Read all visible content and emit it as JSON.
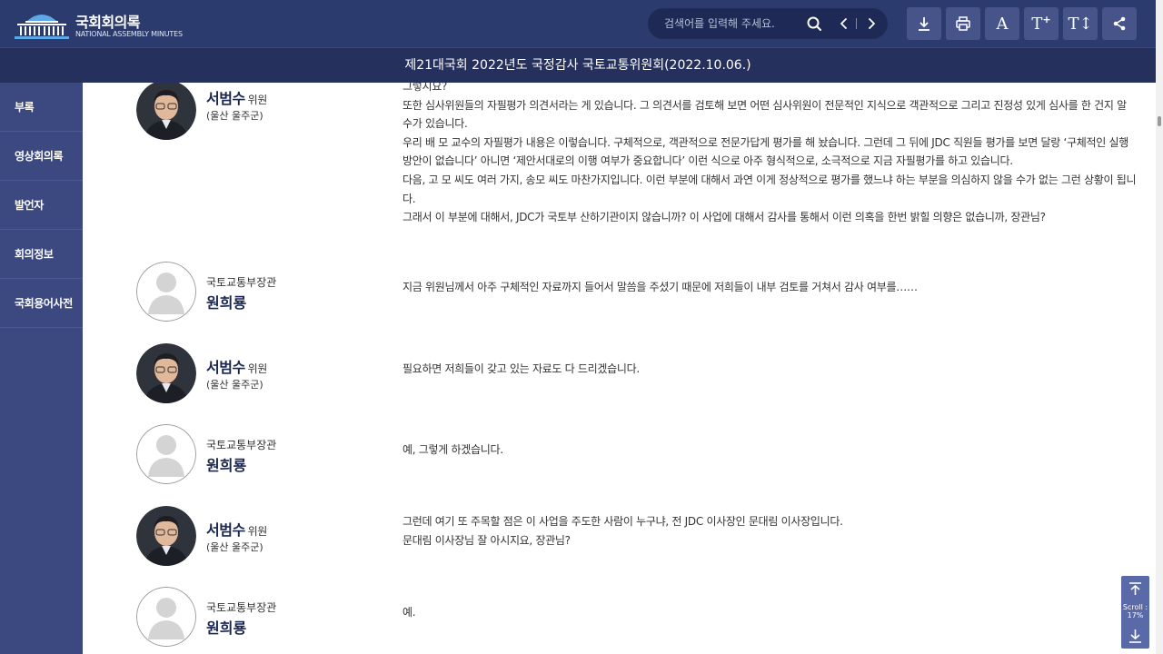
{
  "header": {
    "logo_title": "국회회의록",
    "logo_subtitle": "NATIONAL ASSEMBLY MINUTES",
    "search_placeholder": "검색어를 입력해 주세요.",
    "tools": [
      "download-icon",
      "print-icon",
      "font-style-icon",
      "font-size-increase-icon",
      "font-size-adjust-icon",
      "share-icon"
    ],
    "colors": {
      "header_bg": "#2c3b6e",
      "title_bg": "#26305c",
      "sidebar_bg": "#3c4880",
      "tool_bg": "#46548a"
    }
  },
  "meeting_title": "제21대국회 2022년도 국정감사 국토교통위원회(2022.10.06.)",
  "sidebar": {
    "items": [
      {
        "label": "부록"
      },
      {
        "label": "영상회의록"
      },
      {
        "label": "발언자"
      },
      {
        "label": "회의정보"
      },
      {
        "label": "국회용어사전"
      }
    ]
  },
  "entries": [
    {
      "speaker": "서범수",
      "role": "위원",
      "district": "(울산 울주군)",
      "lines": [
        "그렇지요?",
        " 또한 심사위원들의 자필평가 의견서라는 게 있습니다. 그 의견서를 검토해 보면 어떤 심사위원이 전문적인 지식으로 객관적으로 그리고 진정성 있게 심사를 한 건지 알 수가 있습니다.",
        " 우리 배 모 교수의 자필평가 내용은 이렇습니다. 구체적으로, 객관적으로 전문가답게 평가를 해 놨습니다. 그런데 그 뒤에 JDC 직원들 평가를 보면 달랑 ‘구체적인 실행 방안이 없습니다’ 아니면 ‘제안서대로의 이행 여부가 중요합니다’ 이런 식으로 아주 형식적으로, 소극적으로 지금 자필평가를 하고 있습니다.",
        " 다음, 고 모 씨도 여러 가지, 송모 씨도 마찬가지입니다. 이런 부분에 대해서 과연 이게 정상적으로 평가를 했느냐 하는 부분을 의심하지 않을 수가 없는 그런 상황이 됩니다.",
        " 그래서 이 부분에 대해서, JDC가 국토부 산하기관이지 않습니까? 이 사업에 대해서 감사를 통해서 이런 의혹을 한번 밝힐 의향은 없습니까, 장관님?"
      ]
    },
    {
      "speaker_title": "국토교통부장관",
      "speaker": "원희룡",
      "lines": [
        "지금 위원님께서 아주 구체적인 자료까지 들어서 말씀을 주셨기 때문에 저희들이 내부 검토를 거쳐서 감사 여부를……"
      ]
    },
    {
      "speaker": "서범수",
      "role": "위원",
      "district": "(울산 울주군)",
      "lines": [
        "필요하면 저희들이 갖고 있는 자료도 다 드리겠습니다."
      ]
    },
    {
      "speaker_title": "국토교통부장관",
      "speaker": "원희룡",
      "lines": [
        "예, 그렇게 하겠습니다."
      ]
    },
    {
      "speaker": "서범수",
      "role": "위원",
      "district": "(울산 울주군)",
      "lines": [
        "그런데 여기 또 주목할 점은 이 사업을 주도한 사람이 누구냐, 전 JDC 이사장인 문대림 이사장입니다.",
        "문대림 이사장님 잘 아시지요, 장관님?"
      ]
    },
    {
      "speaker_title": "국토교통부장관",
      "speaker": "원희룡",
      "lines": [
        "예."
      ]
    }
  ],
  "scroll_widget": {
    "label_line1": "Scroll :",
    "label_line2": "17%",
    "percent": 17
  }
}
